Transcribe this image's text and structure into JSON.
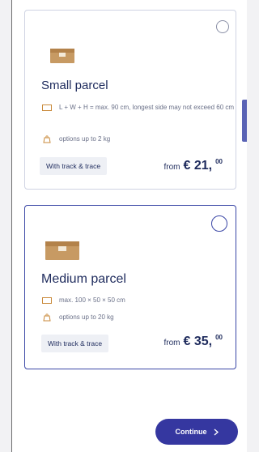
{
  "cards": [
    {
      "title": "Small parcel",
      "size": "L + W + H = max. 90 cm, longest side may not exceed 60 cm",
      "options": "options up to 2 kg",
      "tag": "With track & trace",
      "price_from": "from",
      "price_whole": "€ 21,",
      "price_cents": "00",
      "selected": false
    },
    {
      "title": "Medium parcel",
      "size": "max. 100 × 50 × 50 cm",
      "options": "options up to 20 kg",
      "tag": "With track & trace",
      "price_from": "from",
      "price_whole": "€ 35,",
      "price_cents": "00",
      "selected": false
    }
  ],
  "continue_label": "Continue",
  "icons": {
    "parcel": "parcel-box-icon",
    "size": "ruler-icon",
    "weight": "weight-icon",
    "chevron": "chevron-right-icon"
  },
  "colors": {
    "primary": "#3537a0",
    "text": "#1d2a5c",
    "parcel": "#c79a63"
  }
}
